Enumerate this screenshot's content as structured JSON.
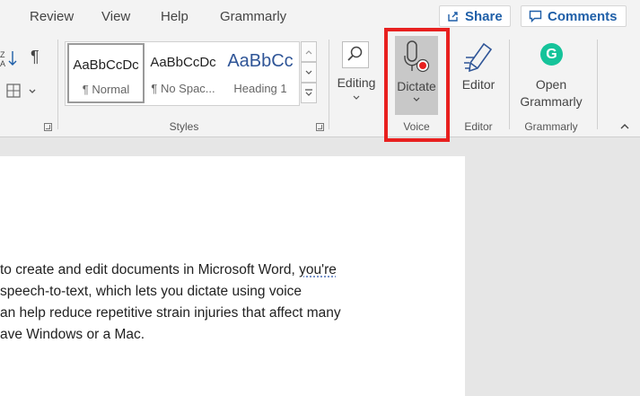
{
  "menu": {
    "items": [
      "Review",
      "View",
      "Help",
      "Grammarly"
    ],
    "share_label": "Share",
    "comments_label": "Comments"
  },
  "ribbon": {
    "paragraph": {
      "pilcrow": "¶"
    },
    "styles": {
      "items": [
        {
          "sample": "AaBbCcDc",
          "name": "¶ Normal"
        },
        {
          "sample": "AaBbCcDc",
          "name": "¶ No Spac..."
        },
        {
          "sample": "AaBbCc",
          "name": "Heading 1"
        }
      ],
      "group_label": "Styles"
    },
    "editing": {
      "label": "Editing"
    },
    "voice": {
      "dictate_label": "Dictate",
      "group_label": "Voice"
    },
    "editor": {
      "label": "Editor",
      "group_label": "Editor"
    },
    "grammarly": {
      "label_line1": "Open",
      "label_line2": "Grammarly",
      "group_label": "Grammarly",
      "logo_letter": "G"
    }
  },
  "document": {
    "lines": [
      {
        "text": "to create and edit documents in Microsoft Word, ",
        "squiggle": "you're"
      },
      {
        "text": "speech-to-text, which lets you dictate using voice"
      },
      {
        "text": "an help reduce repetitive strain injuries that affect many"
      },
      {
        "text": "ave Windows or a Mac."
      }
    ]
  },
  "colors": {
    "accent_blue": "#1f5fa8",
    "highlight_red": "#e8201f",
    "grammarly_green": "#15c39a",
    "dictate_selected": "#c8c8c8"
  }
}
